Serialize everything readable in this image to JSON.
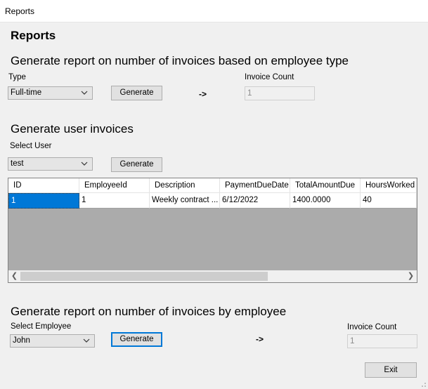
{
  "window": {
    "title": "Reports"
  },
  "page": {
    "heading": "Reports"
  },
  "section1": {
    "heading": "Generate report on number of invoices based on employee type",
    "type_label": "Type",
    "type_value": "Full-time",
    "generate_label": "Generate",
    "arrow": "->",
    "count_label": "Invoice Count",
    "count_value": "1"
  },
  "section2": {
    "heading": "Generate user invoices",
    "user_label": "Select User",
    "user_value": "test",
    "generate_label": "Generate",
    "grid": {
      "columns": [
        "ID",
        "EmployeeId",
        "Description",
        "PaymentDueDate",
        "TotalAmountDue",
        "HoursWorked"
      ],
      "rows": [
        [
          "1",
          "1",
          "Weekly contract ...",
          "6/12/2022",
          "1400.0000",
          "40"
        ]
      ]
    }
  },
  "section3": {
    "heading": "Generate report on number of invoices by employee",
    "employee_label": "Select Employee",
    "employee_value": "John",
    "generate_label": "Generate",
    "arrow": "->",
    "count_label": "Invoice Count",
    "count_value": "1"
  },
  "footer": {
    "exit_label": "Exit"
  }
}
